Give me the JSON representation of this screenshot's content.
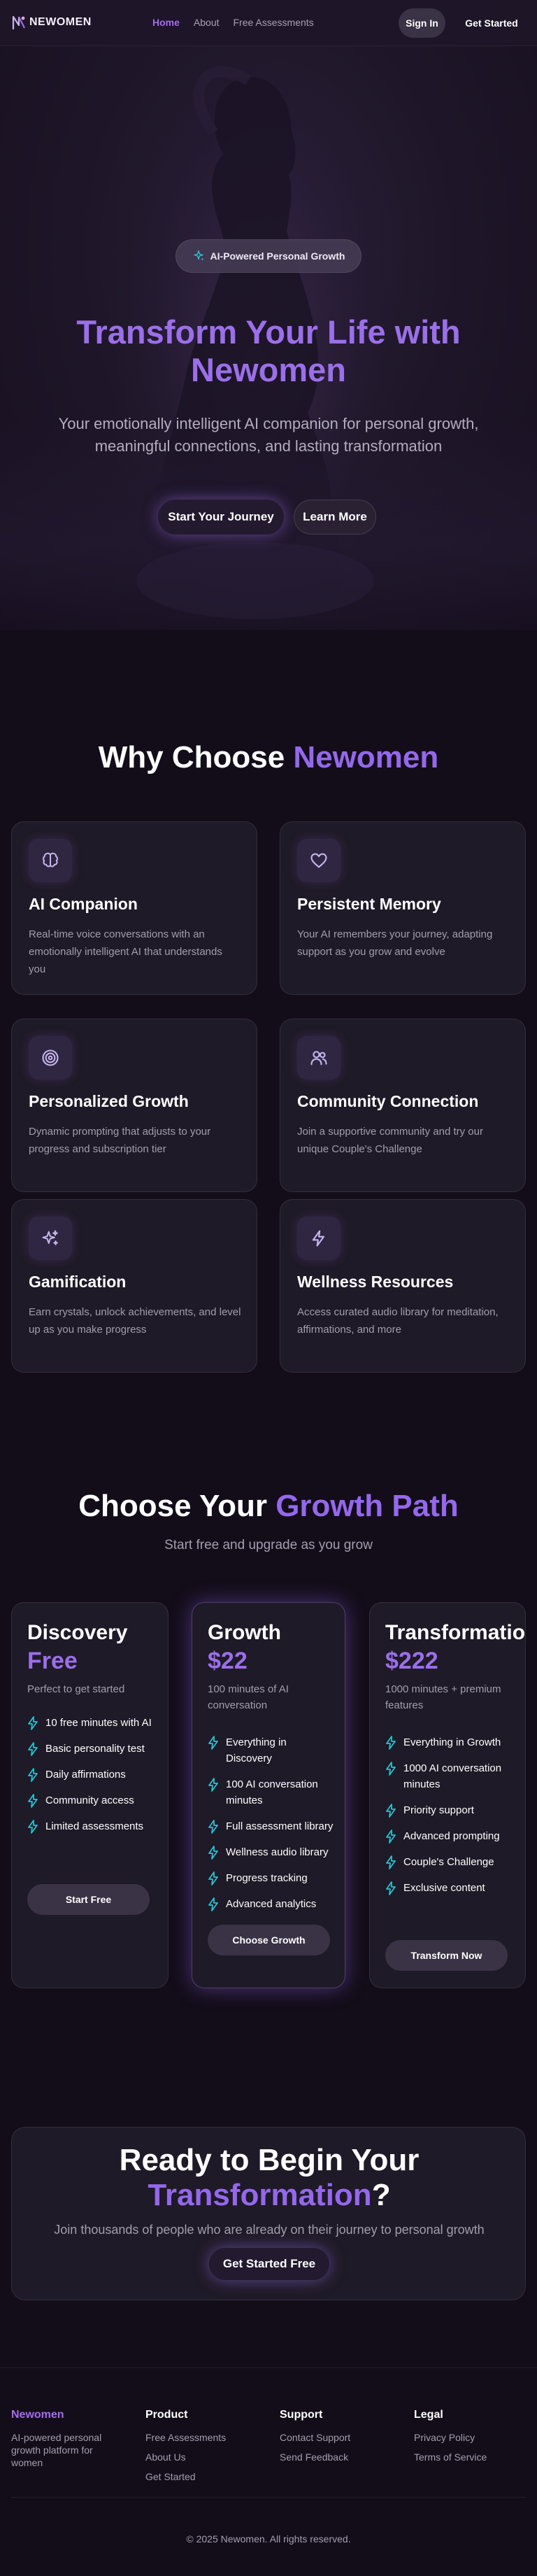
{
  "nav": {
    "logo": "NEWOMEN",
    "links": [
      "Home",
      "About",
      "Free Assessments"
    ],
    "signin": "Sign In",
    "get_started": "Get Started"
  },
  "hero": {
    "badge": "AI-Powered Personal Growth",
    "title_line1": "Transform Your Life with",
    "title_line2": "Newomen",
    "subtitle": "Your emotionally intelligent AI companion for personal growth, meaningful connections, and lasting transformation",
    "primary_button": "Start Your Journey",
    "secondary_button": "Learn More"
  },
  "features": {
    "title_plain": "Why Choose ",
    "title_accent": "Newomen",
    "items": [
      {
        "icon": "brain-icon",
        "title": "AI Companion",
        "desc": "Real-time voice conversations with an emotionally intelligent AI that understands you"
      },
      {
        "icon": "heart-icon",
        "title": "Persistent Memory",
        "desc": "Your AI remembers your journey, adapting support as you grow and evolve"
      },
      {
        "icon": "target-icon",
        "title": "Personalized Growth",
        "desc": "Dynamic prompting that adjusts to your progress and subscription tier"
      },
      {
        "icon": "users-icon",
        "title": "Community Connection",
        "desc": "Join a supportive community and try our unique Couple's Challenge"
      },
      {
        "icon": "sparkles-icon",
        "title": "Gamification",
        "desc": "Earn crystals, unlock achievements, and level up as you make progress"
      },
      {
        "icon": "zap-icon",
        "title": "Wellness Resources",
        "desc": "Access curated audio library for meditation, affirmations, and more"
      }
    ]
  },
  "pricing": {
    "title_plain": "Choose Your ",
    "title_accent": "Growth Path",
    "subtitle": "Start free and upgrade as you grow",
    "plans": [
      {
        "name": "Discovery",
        "price": "Free",
        "desc": "Perfect to get started",
        "features": [
          "10 free minutes with AI",
          "Basic personality test",
          "Daily affirmations",
          "Community access",
          "Limited assessments"
        ],
        "button": "Start Free"
      },
      {
        "name": "Growth",
        "price": "$22",
        "desc": "100 minutes of AI conversation",
        "features": [
          "Everything in Discovery",
          "100 AI conversation minutes",
          "Full assessment library",
          "Wellness audio library",
          "Progress tracking",
          "Advanced analytics"
        ],
        "button": "Choose Growth"
      },
      {
        "name": "Transformation",
        "price": "$222",
        "desc": "1000 minutes + premium features",
        "features": [
          "Everything in Growth",
          "1000 AI conversation minutes",
          "Priority support",
          "Advanced prompting",
          "Couple's Challenge",
          "Exclusive content"
        ],
        "button": "Transform Now"
      }
    ]
  },
  "cta": {
    "title_line1": "Ready to Begin Your",
    "title_accent": "Transformation",
    "title_suffix": "?",
    "subtitle": "Join thousands of people who are already on their journey to personal growth",
    "button": "Get Started Free"
  },
  "footer": {
    "brand": "Newomen",
    "tagline": "AI-powered personal growth platform for women",
    "product": {
      "heading": "Product",
      "links": [
        "Free Assessments",
        "About Us",
        "Get Started"
      ]
    },
    "support": {
      "heading": "Support",
      "links": [
        "Contact Support",
        "Send Feedback"
      ]
    },
    "legal": {
      "heading": "Legal",
      "links": [
        "Privacy Policy",
        "Terms of Service"
      ]
    },
    "copyright": "© 2025 Newomen. All rights reserved."
  },
  "colors": {
    "accent": "#9b6fea",
    "active_link": "#a56cf0",
    "bolt": "#27c3d1",
    "background": "#130d19",
    "card": "#1f1a27"
  }
}
